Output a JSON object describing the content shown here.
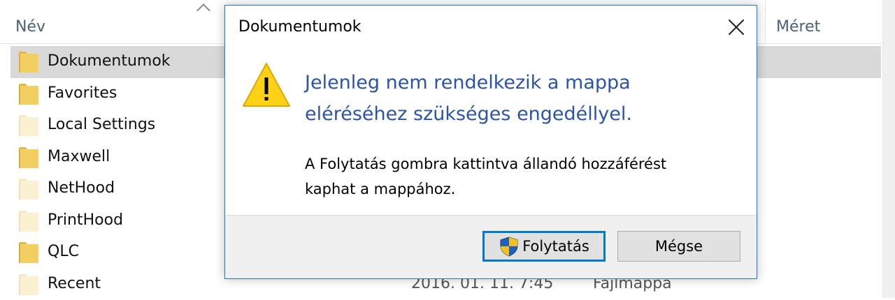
{
  "explorer": {
    "columns": {
      "name": "Név",
      "size": "Méret"
    },
    "folders": [
      {
        "name": "Dokumentumok",
        "selected": true,
        "faded": false
      },
      {
        "name": "Favorites",
        "selected": false,
        "faded": false
      },
      {
        "name": "Local Settings",
        "selected": false,
        "faded": true
      },
      {
        "name": "Maxwell",
        "selected": false,
        "faded": false
      },
      {
        "name": "NetHood",
        "selected": false,
        "faded": true
      },
      {
        "name": "PrintHood",
        "selected": false,
        "faded": true
      },
      {
        "name": "QLC",
        "selected": false,
        "faded": false
      },
      {
        "name": "Recent",
        "selected": false,
        "faded": true
      }
    ],
    "bottom_row": {
      "date": "2016. 01. 11. 7:45",
      "type": "Fájlmappa"
    }
  },
  "dialog": {
    "title": "Dokumentumok",
    "main_instruction_line1": "Jelenleg nem rendelkezik a mappa",
    "main_instruction_line2": "eléréséhez szükséges engedéllyel.",
    "content_line1": "A Folytatás gombra kattintva állandó hozzáférést",
    "content_line2": "kaphat a mappához.",
    "continue_label": "Folytatás",
    "cancel_label": "Mégse",
    "icons": {
      "warning": "warning-icon",
      "shield": "uac-shield-icon",
      "close": "close-icon"
    }
  },
  "colors": {
    "accent": "#0078d7",
    "instruction_text": "#2b55a4",
    "selection": "#d9d9d9",
    "folder": "#f3cf62"
  }
}
